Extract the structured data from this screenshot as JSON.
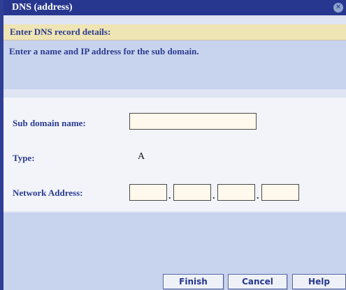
{
  "window": {
    "title": "DNS (address)",
    "close_icon": "close-icon"
  },
  "header": {
    "text": "Enter DNS record details:"
  },
  "instruction": {
    "text": "Enter a name and IP address for the sub domain."
  },
  "form": {
    "subdomain_label": "Sub domain name:",
    "subdomain_value": "",
    "type_label": "Type:",
    "type_value": "A",
    "network_label": "Network Address:",
    "octets": [
      "",
      "",
      "",
      ""
    ],
    "separator": "."
  },
  "buttons": {
    "finish": "Finish",
    "cancel": "Cancel",
    "help": "Help"
  },
  "colors": {
    "titlebar": "#27378f",
    "header": "#efe5b4",
    "panel": "#c8d4ee",
    "text": "#2b3b8f"
  }
}
